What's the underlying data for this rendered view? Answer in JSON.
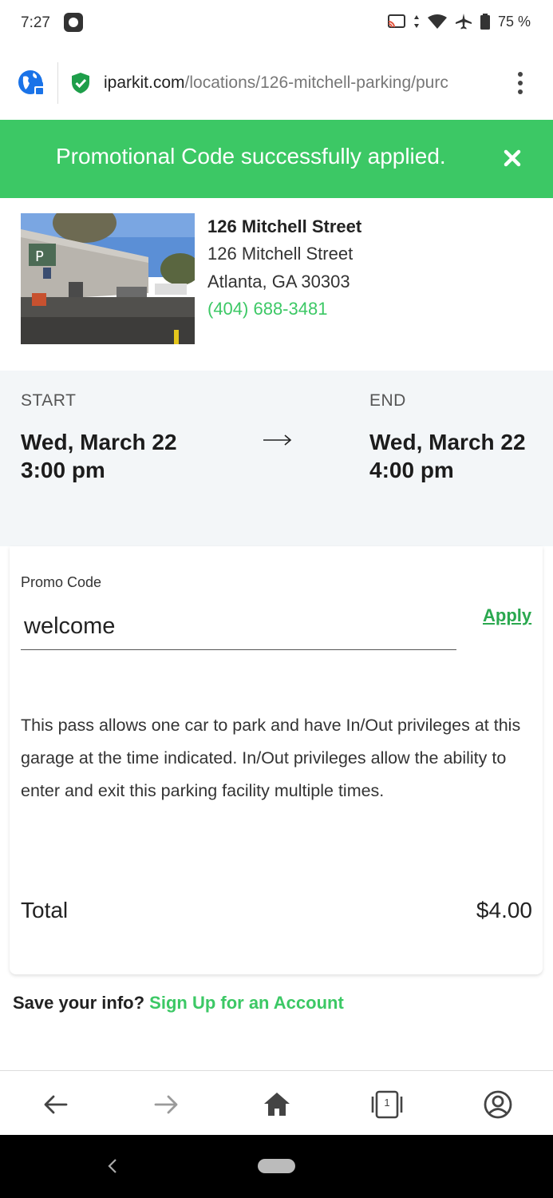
{
  "status_bar": {
    "time": "7:27",
    "battery": "75 %"
  },
  "browser": {
    "url_domain": "iparkit.com",
    "url_path": "/locations/126-mitchell-parking/purc"
  },
  "banner": {
    "message": "Promotional Code successfully applied."
  },
  "location": {
    "name": "126 Mitchell Street",
    "street": "126 Mitchell Street",
    "city": "Atlanta, GA 30303",
    "phone": "(404) 688-3481"
  },
  "times": {
    "start_label": "START",
    "start_date": "Wed, March 22",
    "start_time": "3:00 pm",
    "end_label": "END",
    "end_date": "Wed, March 22",
    "end_time": "4:00 pm"
  },
  "promo": {
    "label": "Promo Code",
    "value": "welcome",
    "apply": "Apply"
  },
  "description": "This pass allows one car to park and have In/Out privileges at this garage at the time indicated. In/Out privileges allow the ability to enter and exit this parking facility multiple times.",
  "total": {
    "label": "Total",
    "value": "$4.00"
  },
  "save_info": {
    "prompt": "Save your info?",
    "link": "Sign Up for an Account"
  },
  "colors": {
    "brand_green": "#3cc865",
    "link_green": "#2aa84f"
  },
  "nav": {
    "icons": [
      "back-arrow-icon",
      "forward-arrow-icon",
      "home-icon",
      "tabs-icon",
      "account-icon"
    ],
    "tab_count": "1"
  }
}
